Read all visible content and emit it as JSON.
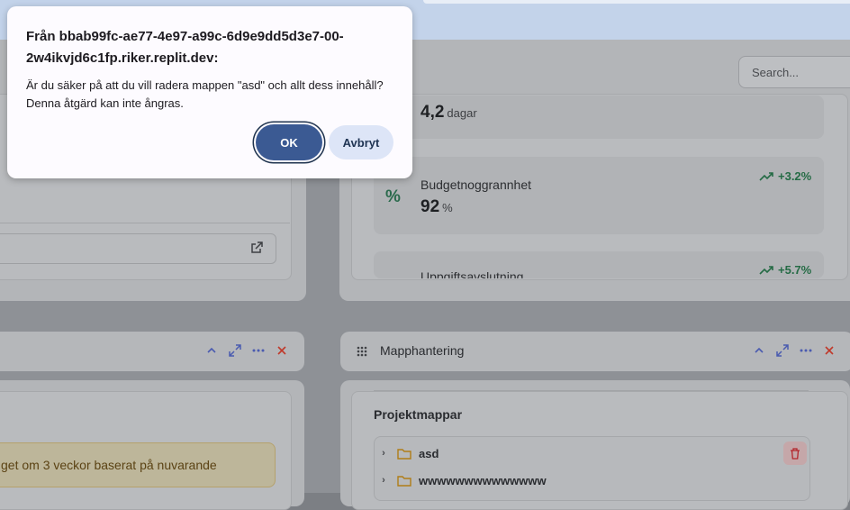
{
  "dialog": {
    "title": "Från bbab99fc-ae77-4e97-a99c-6d9e9dd5d3e7-00-2w4ikvjd6c1fp.riker.replit.dev:",
    "message_line1": "Är du säker på att du vill radera mappen \"asd\" och allt dess innehåll?",
    "message_line2": "Denna åtgärd kan inte ångras.",
    "ok_label": "OK",
    "cancel_label": "Avbryt"
  },
  "search": {
    "placeholder": "Search..."
  },
  "metrics": [
    {
      "value": "4,2",
      "unit": "dagar"
    },
    {
      "label": "Budgetnoggrannhet",
      "value": "92",
      "unit": "%",
      "trend": "+3.2%",
      "icon": "percent-icon"
    },
    {
      "label": "Uppgiftsavslutning",
      "trend": "+5.7%"
    }
  ],
  "left_widget": {
    "warning_text": "get om 3 veckor baserat på nuvarande"
  },
  "folder_panel": {
    "title": "Mapphantering",
    "section_title": "Projektmappar",
    "folders": [
      {
        "name": "asd"
      },
      {
        "name": "wwwwwwwwwwwwww"
      }
    ]
  },
  "colors": {
    "ok_button": "#3b5a93",
    "cancel_button": "#dde5f7",
    "trend_positive": "#256b45",
    "close_icon": "#c0392b",
    "header_icons": "#4a5bb0"
  }
}
